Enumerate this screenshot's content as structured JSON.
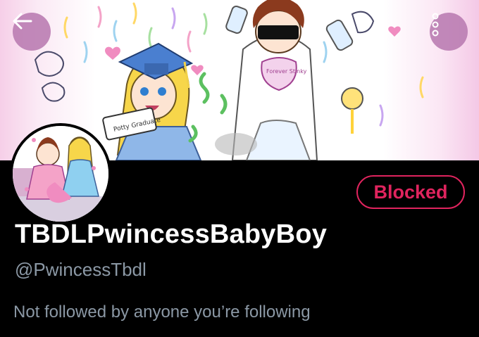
{
  "profile": {
    "display_name": "TBDLPwincessBabyBoy",
    "handle": "@PwincessTbdl",
    "followed_by_note": "Not followed by anyone you’re following",
    "relationship_button_label": "Blocked"
  },
  "banner": {
    "bib_text": "Forever Stinky",
    "diploma_text": "Potty Graduate"
  },
  "icons": {
    "back": "back-arrow-icon",
    "more": "more-options-icon"
  },
  "colors": {
    "background": "#000000",
    "blocked_accent": "#e0245e",
    "secondary_text": "#8b98a5",
    "overlay_button": "#b87ab0"
  }
}
